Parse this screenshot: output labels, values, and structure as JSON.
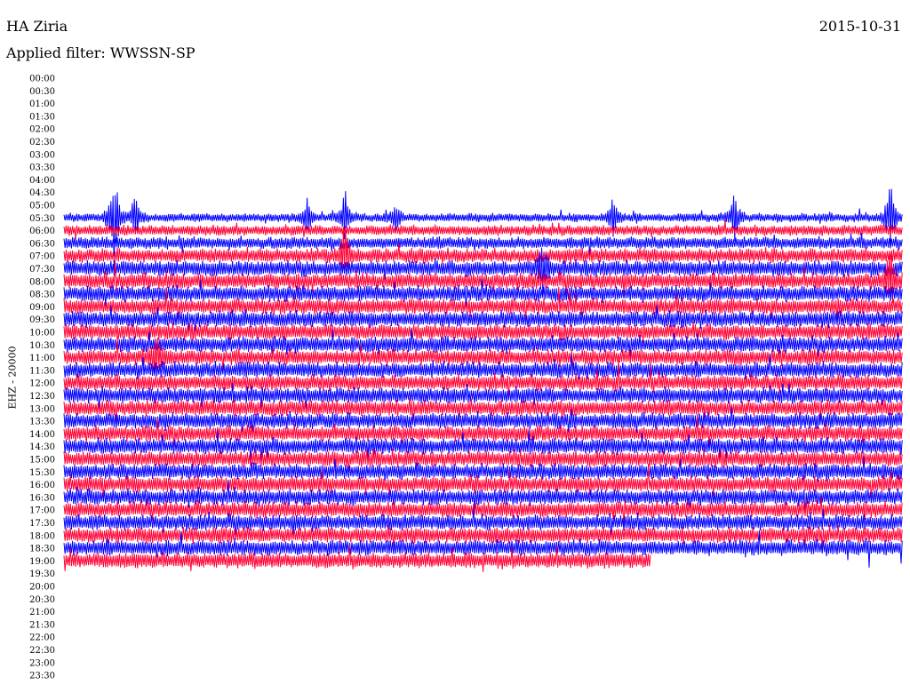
{
  "header": {
    "station": "HA Ziria",
    "date": "2015-10-31",
    "filter": "Applied filter: WWSSN-SP"
  },
  "chart_data": {
    "type": "line",
    "channel_label": "EHZ - 20000",
    "colors": [
      "#0000ff",
      "#ff0033"
    ],
    "y_ticks": [
      "00:00",
      "00:30",
      "01:00",
      "01:30",
      "02:00",
      "02:30",
      "03:00",
      "03:30",
      "04:00",
      "04:30",
      "05:00",
      "05:30",
      "06:00",
      "06:30",
      "07:00",
      "07:30",
      "08:00",
      "08:30",
      "09:00",
      "09:30",
      "10:00",
      "10:30",
      "11:00",
      "11:30",
      "12:00",
      "12:30",
      "13:00",
      "13:30",
      "14:00",
      "14:30",
      "15:00",
      "15:30",
      "16:00",
      "16:30",
      "17:00",
      "17:30",
      "18:00",
      "18:30",
      "19:00",
      "19:30",
      "20:00",
      "20:30",
      "21:00",
      "21:30",
      "22:00",
      "22:30",
      "23:00",
      "23:30"
    ],
    "first_trace": "05:30",
    "last_trace": "19:00",
    "last_trace_end_fraction": 0.7,
    "events": [
      {
        "time": "05:30",
        "x_fraction": 0.06,
        "amplitude": 12
      },
      {
        "time": "05:30",
        "x_fraction": 0.085,
        "amplitude": 5
      },
      {
        "time": "05:30",
        "x_fraction": 0.29,
        "amplitude": 3
      },
      {
        "time": "05:30",
        "x_fraction": 0.335,
        "amplitude": 5
      },
      {
        "time": "05:30",
        "x_fraction": 0.395,
        "amplitude": 3
      },
      {
        "time": "05:30",
        "x_fraction": 0.655,
        "amplitude": 4
      },
      {
        "time": "05:30",
        "x_fraction": 0.8,
        "amplitude": 5
      },
      {
        "time": "05:30",
        "x_fraction": 0.985,
        "amplitude": 8
      },
      {
        "time": "07:00",
        "x_fraction": 0.335,
        "amplitude": 4
      },
      {
        "time": "07:30",
        "x_fraction": 0.57,
        "amplitude": 3
      },
      {
        "time": "08:00",
        "x_fraction": 0.985,
        "amplitude": 4
      },
      {
        "time": "11:00",
        "x_fraction": 0.11,
        "amplitude": 3
      }
    ]
  }
}
